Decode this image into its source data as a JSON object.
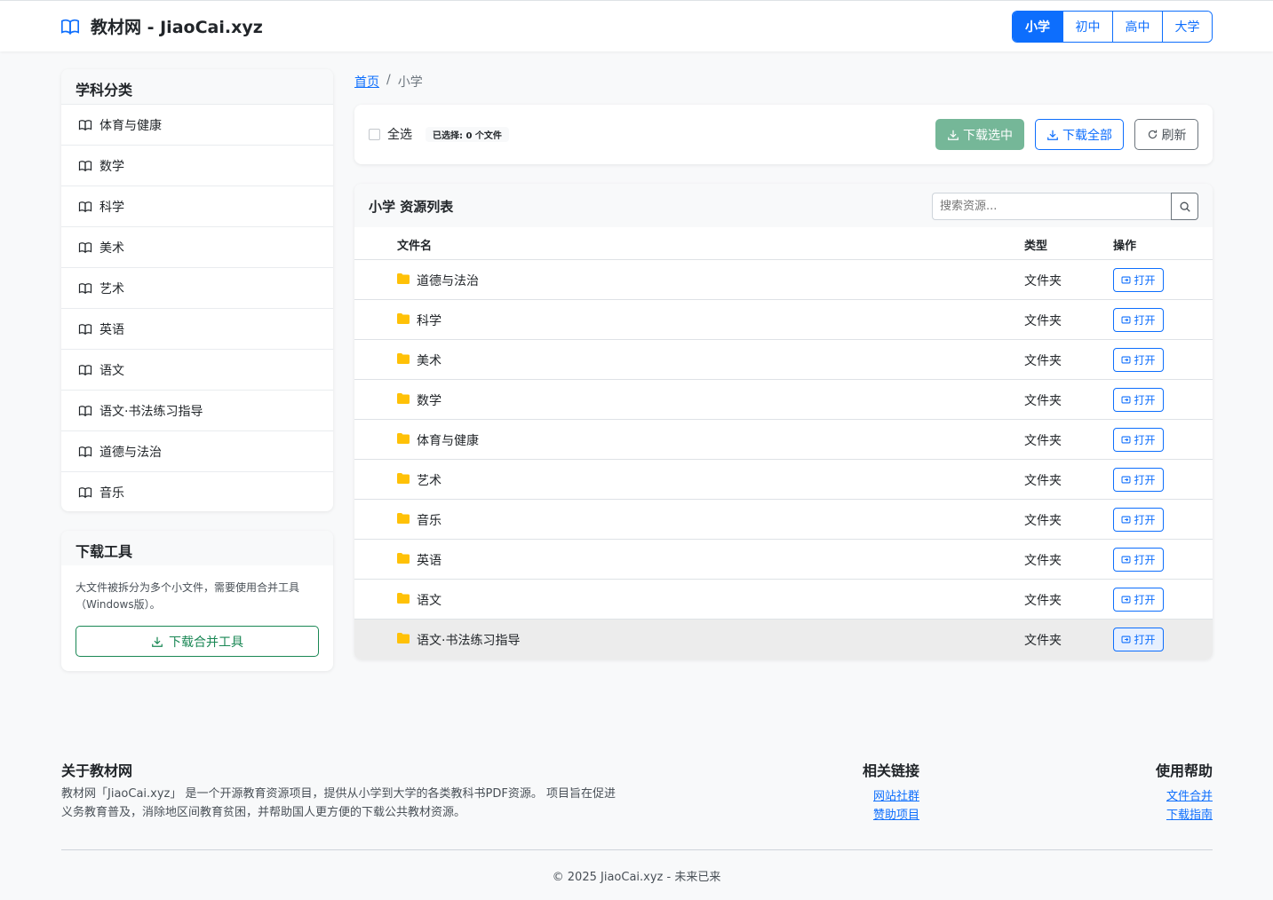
{
  "header": {
    "site_title": "教材网 - JiaoCai.xyz",
    "levels": [
      "小学",
      "初中",
      "高中",
      "大学"
    ],
    "active_level": "小学",
    "brand_color": "#0d6efd"
  },
  "sidebar": {
    "subjects_title": "学科分类",
    "subjects": [
      "体育与健康",
      "数学",
      "科学",
      "美术",
      "艺术",
      "英语",
      "语文",
      "语文·书法练习指导",
      "道德与法治",
      "音乐"
    ],
    "tools_title": "下载工具",
    "tools_desc": "大文件被拆分为多个小文件，需要使用合并工具（Windows版）。",
    "merge_button": "下载合并工具"
  },
  "breadcrumb": {
    "home": "首页",
    "separator": "/",
    "current": "小学"
  },
  "toolbar": {
    "select_all": "全选",
    "selected_info": "已选择: 0 个文件",
    "download_selected": "下载选中",
    "download_all": "下载全部",
    "refresh": "刷新"
  },
  "list": {
    "title": "小学 资源列表",
    "search_placeholder": "搜索资源...",
    "columns": {
      "name": "文件名",
      "type": "类型",
      "action": "操作"
    },
    "rows": [
      {
        "name": "道德与法治",
        "type": "文件夹",
        "action": "打开"
      },
      {
        "name": "科学",
        "type": "文件夹",
        "action": "打开"
      },
      {
        "name": "美术",
        "type": "文件夹",
        "action": "打开"
      },
      {
        "name": "数学",
        "type": "文件夹",
        "action": "打开"
      },
      {
        "name": "体育与健康",
        "type": "文件夹",
        "action": "打开"
      },
      {
        "name": "艺术",
        "type": "文件夹",
        "action": "打开"
      },
      {
        "name": "音乐",
        "type": "文件夹",
        "action": "打开"
      },
      {
        "name": "英语",
        "type": "文件夹",
        "action": "打开"
      },
      {
        "name": "语文",
        "type": "文件夹",
        "action": "打开"
      },
      {
        "name": "语文·书法练习指导",
        "type": "文件夹",
        "action": "打开"
      }
    ]
  },
  "footer": {
    "about_title": "关于教材网",
    "about_text": "教材网「JiaoCai.xyz」 是一个开源教育资源项目，提供从小学到大学的各类教科书PDF资源。 项目旨在促进义务教育普及，消除地区间教育贫困，并帮助国人更方便的下载公共教材资源。",
    "links_title": "相关链接",
    "links": [
      "网站社群",
      "赞助项目"
    ],
    "help_title": "使用帮助",
    "help_links": [
      "文件合并",
      "下载指南"
    ],
    "copyright": "© 2025 JiaoCai.xyz - 未来已来"
  },
  "icons": {
    "brand": "book-open-icon",
    "subject": "book-icon",
    "folder": "folder-icon",
    "download": "download-icon",
    "refresh": "refresh-icon",
    "search": "search-icon",
    "open": "open-folder-icon"
  },
  "colors": {
    "folder": "#ffc107",
    "success": "#198754",
    "primary": "#0d6efd"
  }
}
